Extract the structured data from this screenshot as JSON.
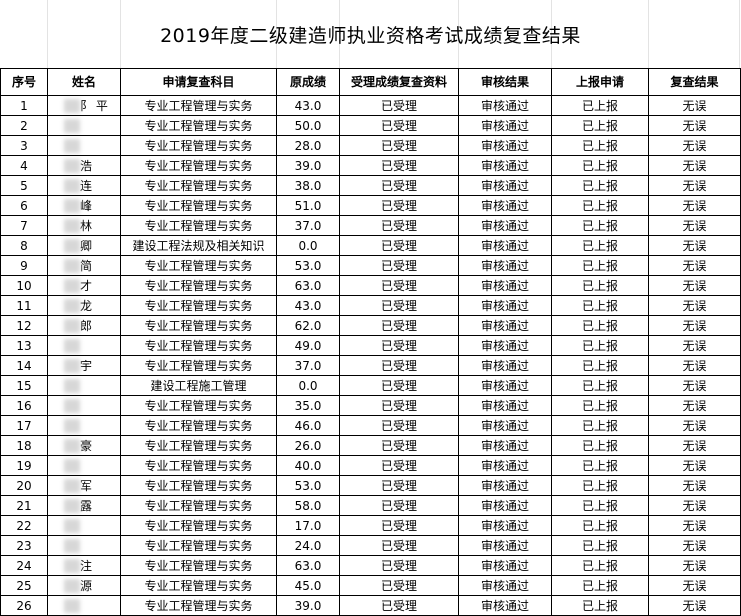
{
  "title": "2019年度二级建造师执业资格考试成绩复查结果",
  "headers": [
    "序号",
    "姓名",
    "申请复查科目",
    "原成绩",
    "受理成绩复查资料",
    "审核结果",
    "上报申请",
    "复查结果"
  ],
  "rows": [
    {
      "no": "1",
      "name": "阝 平",
      "subject": "专业工程管理与实务",
      "score": "43.0",
      "accept": "已受理",
      "audit": "审核通过",
      "report": "已上报",
      "result": "无误"
    },
    {
      "no": "2",
      "name": "",
      "subject": "专业工程管理与实务",
      "score": "50.0",
      "accept": "已受理",
      "audit": "审核通过",
      "report": "已上报",
      "result": "无误"
    },
    {
      "no": "3",
      "name": "",
      "subject": "专业工程管理与实务",
      "score": "28.0",
      "accept": "已受理",
      "audit": "审核通过",
      "report": "已上报",
      "result": "无误"
    },
    {
      "no": "4",
      "name": "  浩",
      "subject": "专业工程管理与实务",
      "score": "39.0",
      "accept": "已受理",
      "audit": "审核通过",
      "report": "已上报",
      "result": "无误"
    },
    {
      "no": "5",
      "name": "  连",
      "subject": "专业工程管理与实务",
      "score": "38.0",
      "accept": "已受理",
      "audit": "审核通过",
      "report": "已上报",
      "result": "无误"
    },
    {
      "no": "6",
      "name": "  峰",
      "subject": "专业工程管理与实务",
      "score": "51.0",
      "accept": "已受理",
      "audit": "审核通过",
      "report": "已上报",
      "result": "无误"
    },
    {
      "no": "7",
      "name": "  林",
      "subject": "专业工程管理与实务",
      "score": "37.0",
      "accept": "已受理",
      "audit": "审核通过",
      "report": "已上报",
      "result": "无误"
    },
    {
      "no": "8",
      "name": "  卿",
      "subject": "建设工程法规及相关知识",
      "score": "0.0",
      "accept": "已受理",
      "audit": "审核通过",
      "report": "已上报",
      "result": "无误"
    },
    {
      "no": "9",
      "name": "  简",
      "subject": "专业工程管理与实务",
      "score": "53.0",
      "accept": "已受理",
      "audit": "审核通过",
      "report": "已上报",
      "result": "无误"
    },
    {
      "no": "10",
      "name": "  才",
      "subject": "专业工程管理与实务",
      "score": "63.0",
      "accept": "已受理",
      "audit": "审核通过",
      "report": "已上报",
      "result": "无误"
    },
    {
      "no": "11",
      "name": "  龙",
      "subject": "专业工程管理与实务",
      "score": "43.0",
      "accept": "已受理",
      "audit": "审核通过",
      "report": "已上报",
      "result": "无误"
    },
    {
      "no": "12",
      "name": "  郎",
      "subject": "专业工程管理与实务",
      "score": "62.0",
      "accept": "已受理",
      "audit": "审核通过",
      "report": "已上报",
      "result": "无误"
    },
    {
      "no": "13",
      "name": "",
      "subject": "专业工程管理与实务",
      "score": "49.0",
      "accept": "已受理",
      "audit": "审核通过",
      "report": "已上报",
      "result": "无误"
    },
    {
      "no": "14",
      "name": "  宇",
      "subject": "专业工程管理与实务",
      "score": "37.0",
      "accept": "已受理",
      "audit": "审核通过",
      "report": "已上报",
      "result": "无误"
    },
    {
      "no": "15",
      "name": "",
      "subject": "建设工程施工管理",
      "score": "0.0",
      "accept": "已受理",
      "audit": "审核通过",
      "report": "已上报",
      "result": "无误"
    },
    {
      "no": "16",
      "name": "",
      "subject": "专业工程管理与实务",
      "score": "35.0",
      "accept": "已受理",
      "audit": "审核通过",
      "report": "已上报",
      "result": "无误"
    },
    {
      "no": "17",
      "name": "",
      "subject": "专业工程管理与实务",
      "score": "46.0",
      "accept": "已受理",
      "audit": "审核通过",
      "report": "已上报",
      "result": "无误"
    },
    {
      "no": "18",
      "name": "  豪",
      "subject": "专业工程管理与实务",
      "score": "26.0",
      "accept": "已受理",
      "audit": "审核通过",
      "report": "已上报",
      "result": "无误"
    },
    {
      "no": "19",
      "name": "",
      "subject": "专业工程管理与实务",
      "score": "40.0",
      "accept": "已受理",
      "audit": "审核通过",
      "report": "已上报",
      "result": "无误"
    },
    {
      "no": "20",
      "name": "  军",
      "subject": "专业工程管理与实务",
      "score": "53.0",
      "accept": "已受理",
      "audit": "审核通过",
      "report": "已上报",
      "result": "无误"
    },
    {
      "no": "21",
      "name": "  露",
      "subject": "专业工程管理与实务",
      "score": "58.0",
      "accept": "已受理",
      "audit": "审核通过",
      "report": "已上报",
      "result": "无误"
    },
    {
      "no": "22",
      "name": "",
      "subject": "专业工程管理与实务",
      "score": "17.0",
      "accept": "已受理",
      "audit": "审核通过",
      "report": "已上报",
      "result": "无误"
    },
    {
      "no": "23",
      "name": "",
      "subject": "专业工程管理与实务",
      "score": "24.0",
      "accept": "已受理",
      "audit": "审核通过",
      "report": "已上报",
      "result": "无误"
    },
    {
      "no": "24",
      "name": "  注",
      "subject": "专业工程管理与实务",
      "score": "63.0",
      "accept": "已受理",
      "audit": "审核通过",
      "report": "已上报",
      "result": "无误"
    },
    {
      "no": "25",
      "name": "  源",
      "subject": "专业工程管理与实务",
      "score": "45.0",
      "accept": "已受理",
      "audit": "审核通过",
      "report": "已上报",
      "result": "无误"
    },
    {
      "no": "26",
      "name": "",
      "subject": "专业工程管理与实务",
      "score": "39.0",
      "accept": "已受理",
      "audit": "审核通过",
      "report": "已上报",
      "result": "无误"
    }
  ]
}
